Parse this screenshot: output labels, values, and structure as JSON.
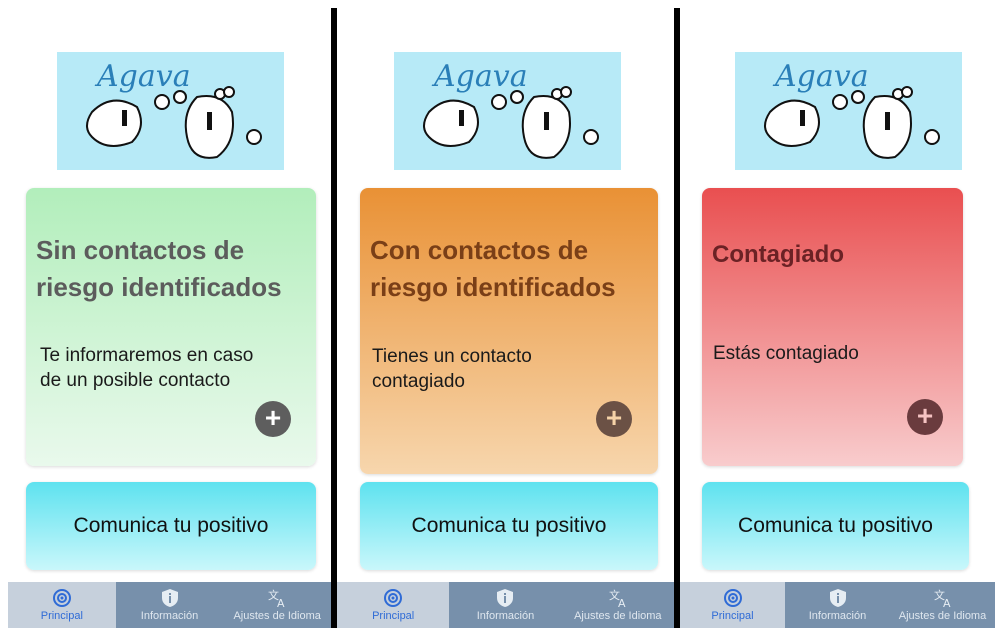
{
  "app": {
    "logo_text": "Agava"
  },
  "panels": [
    {
      "status_title_line1": "Sin contactos de",
      "status_title_line2": "riesgo identificados",
      "status_desc_line1": "Te informaremos en caso",
      "status_desc_line2": "de un posible contacto",
      "status_color": "#b2eebb",
      "plus_label": "+",
      "report_label": "Comunica tu positivo"
    },
    {
      "status_title_line1": "Con contactos de",
      "status_title_line2": "riesgo identificados",
      "status_desc_line1": "Tienes un contacto",
      "status_desc_line2": "contagiado",
      "status_color": "#e99135",
      "plus_label": "+",
      "report_label": "Comunica tu positivo"
    },
    {
      "status_title_line1": "Contagiado",
      "status_title_line2": "",
      "status_desc_line1": "Estás contagiado",
      "status_desc_line2": "",
      "status_color": "#e94f50",
      "plus_label": "+",
      "report_label": "Comunica tu positivo"
    }
  ],
  "tabs": [
    {
      "label": "Principal",
      "icon": "radar-icon",
      "active": true
    },
    {
      "label": "Información",
      "icon": "shield-info-icon",
      "active": false
    },
    {
      "label": "Ajustes de Idioma",
      "icon": "translate-icon",
      "active": false
    }
  ],
  "colors": {
    "tabbar": "#7790ab",
    "tab_active": "#c6d0dc",
    "accent_blue": "#2f6bd6",
    "report_button": "#5ee2ef"
  }
}
